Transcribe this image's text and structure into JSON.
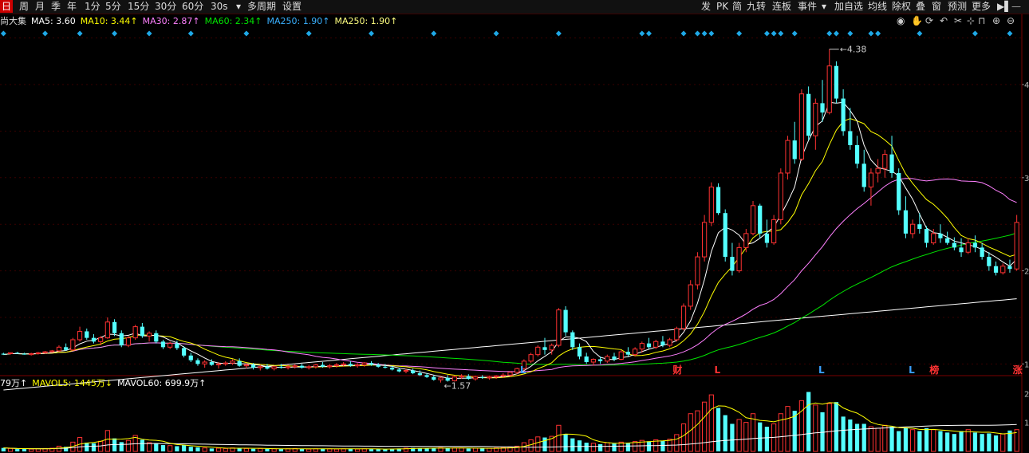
{
  "toolbar": {
    "left": [
      "日",
      "周",
      "月",
      "季",
      "年",
      "1分",
      "5分",
      "15分",
      "30分",
      "60分",
      "30s",
      "▾",
      "多周期",
      "设置"
    ],
    "right": [
      "发",
      "PK",
      "简",
      "九转",
      "连板",
      "事件",
      "▾",
      "加自选",
      "均线",
      "除权",
      "叠",
      "窗",
      "预测",
      "更多"
    ]
  },
  "legend": {
    "name": "尚大集",
    "ma5": "MA5: 3.60",
    "ma10": "MA10: 3.44↑",
    "ma30": "MA30: 2.87↑",
    "ma60": "MA60: 2.34↑",
    "ma250a": "MA250: 1.90↑",
    "ma250b": "MA250: 1.90↑"
  },
  "vol_legend": {
    "vol": "79万↑",
    "mavol5": "MAVOL5: 1445万↓",
    "mavol60": "MAVOL60: 699.9万↑"
  },
  "colors": {
    "up": "#ff3232",
    "down": "#54ffff",
    "ma5": "#ffffff",
    "ma10": "#ffff00",
    "ma30": "#ff80ff",
    "ma60": "#00e600",
    "ma250": "#ffffff",
    "vol_ma5": "#ffff00",
    "vol_ma60": "#ffffff",
    "signal": "#1fa8e6",
    "axis": "#7a0000",
    "marker_l": "#3aa0ff",
    "marker_fin": "#ff3232"
  },
  "chart_data": {
    "type": "candlestick",
    "ylim": [
      0.9,
      4.6
    ],
    "yticks": [
      "1",
      "2",
      "3",
      "4"
    ],
    "vol_ticks": [
      "2",
      "1"
    ],
    "max_label": "4.38",
    "min_label": "1.57",
    "markers": [
      "L",
      "财",
      "L",
      "L",
      "L",
      "榜",
      "涨"
    ],
    "candles": [
      [
        1.11,
        1.12,
        1.1,
        1.1
      ],
      [
        1.11,
        1.12,
        1.1,
        1.12
      ],
      [
        1.12,
        1.13,
        1.11,
        1.11
      ],
      [
        1.11,
        1.12,
        1.1,
        1.1
      ],
      [
        1.1,
        1.12,
        1.09,
        1.11
      ],
      [
        1.11,
        1.13,
        1.1,
        1.12
      ],
      [
        1.12,
        1.14,
        1.11,
        1.13
      ],
      [
        1.13,
        1.15,
        1.12,
        1.14
      ],
      [
        1.14,
        1.2,
        1.13,
        1.18
      ],
      [
        1.18,
        1.22,
        1.14,
        1.15
      ],
      [
        1.15,
        1.28,
        1.14,
        1.26
      ],
      [
        1.26,
        1.4,
        1.24,
        1.35
      ],
      [
        1.35,
        1.38,
        1.26,
        1.28
      ],
      [
        1.28,
        1.32,
        1.22,
        1.24
      ],
      [
        1.24,
        1.3,
        1.2,
        1.28
      ],
      [
        1.28,
        1.5,
        1.27,
        1.45
      ],
      [
        1.45,
        1.48,
        1.3,
        1.33
      ],
      [
        1.33,
        1.36,
        1.18,
        1.2
      ],
      [
        1.2,
        1.3,
        1.18,
        1.28
      ],
      [
        1.28,
        1.42,
        1.26,
        1.4
      ],
      [
        1.4,
        1.44,
        1.28,
        1.3
      ],
      [
        1.3,
        1.35,
        1.24,
        1.33
      ],
      [
        1.33,
        1.36,
        1.22,
        1.24
      ],
      [
        1.24,
        1.26,
        1.16,
        1.18
      ],
      [
        1.18,
        1.24,
        1.16,
        1.22
      ],
      [
        1.22,
        1.25,
        1.15,
        1.17
      ],
      [
        1.17,
        1.19,
        1.07,
        1.09
      ],
      [
        1.09,
        1.12,
        1.02,
        1.04
      ],
      [
        1.04,
        1.06,
        0.98,
        1.0
      ],
      [
        1.0,
        1.04,
        0.96,
        1.02
      ],
      [
        1.02,
        1.05,
        0.98,
        0.99
      ],
      [
        0.99,
        1.02,
        0.95,
        1.0
      ],
      [
        1.0,
        1.03,
        0.98,
        1.01
      ],
      [
        1.01,
        1.05,
        0.99,
        1.03
      ],
      [
        1.03,
        1.06,
        0.97,
        0.98
      ],
      [
        0.98,
        1.01,
        0.95,
        0.99
      ],
      [
        0.99,
        1.01,
        0.94,
        0.96
      ],
      [
        0.96,
        0.99,
        0.93,
        0.97
      ],
      [
        0.97,
        1.0,
        0.94,
        0.95
      ],
      [
        0.95,
        0.98,
        0.93,
        0.97
      ],
      [
        0.97,
        1.0,
        0.95,
        0.96
      ],
      [
        0.96,
        0.99,
        0.94,
        0.97
      ],
      [
        0.97,
        1.0,
        0.95,
        0.98
      ],
      [
        0.98,
        1.0,
        0.95,
        0.96
      ],
      [
        0.96,
        0.99,
        0.94,
        0.97
      ],
      [
        0.97,
        1.0,
        0.95,
        0.99
      ],
      [
        0.99,
        1.02,
        0.96,
        0.97
      ],
      [
        0.97,
        1.0,
        0.95,
        0.98
      ],
      [
        0.98,
        1.01,
        0.96,
        0.99
      ],
      [
        0.99,
        1.02,
        0.97,
        1.0
      ],
      [
        1.0,
        1.03,
        0.97,
        0.98
      ],
      [
        0.98,
        1.01,
        0.96,
        0.99
      ],
      [
        0.99,
        1.02,
        0.97,
        1.01
      ],
      [
        1.01,
        1.03,
        0.98,
        0.99
      ],
      [
        0.99,
        1.01,
        0.96,
        0.97
      ],
      [
        0.97,
        1.0,
        0.95,
        0.96
      ],
      [
        0.96,
        0.98,
        0.93,
        0.94
      ],
      [
        0.94,
        0.96,
        0.91,
        0.92
      ],
      [
        0.92,
        0.95,
        0.9,
        0.93
      ],
      [
        0.93,
        0.95,
        0.89,
        0.9
      ],
      [
        0.9,
        0.93,
        0.87,
        0.88
      ],
      [
        0.88,
        0.9,
        0.85,
        0.86
      ],
      [
        0.86,
        0.88,
        0.82,
        0.83
      ],
      [
        0.83,
        0.86,
        0.8,
        0.85
      ],
      [
        0.85,
        0.88,
        0.81,
        0.82
      ],
      [
        0.82,
        0.87,
        0.81,
        0.86
      ],
      [
        0.86,
        0.89,
        0.84,
        0.87
      ],
      [
        0.87,
        0.89,
        0.83,
        0.84
      ],
      [
        0.84,
        0.87,
        0.82,
        0.86
      ],
      [
        0.86,
        0.88,
        0.84,
        0.85
      ],
      [
        0.85,
        0.87,
        0.83,
        0.86
      ],
      [
        0.86,
        0.88,
        0.84,
        0.87
      ],
      [
        0.87,
        0.9,
        0.85,
        0.88
      ],
      [
        0.88,
        0.92,
        0.86,
        0.91
      ],
      [
        0.91,
        0.96,
        0.89,
        0.95
      ],
      [
        0.95,
        1.05,
        0.93,
        1.03
      ],
      [
        1.03,
        1.12,
        1.01,
        1.1
      ],
      [
        1.1,
        1.2,
        1.08,
        1.18
      ],
      [
        1.18,
        1.28,
        1.1,
        1.15
      ],
      [
        1.15,
        1.22,
        1.1,
        1.2
      ],
      [
        1.2,
        1.6,
        1.18,
        1.58
      ],
      [
        1.58,
        1.62,
        1.3,
        1.34
      ],
      [
        1.34,
        1.36,
        1.15,
        1.18
      ],
      [
        1.18,
        1.22,
        1.05,
        1.08
      ],
      [
        1.08,
        1.12,
        1.0,
        1.02
      ],
      [
        1.02,
        1.06,
        0.98,
        1.05
      ],
      [
        1.05,
        1.08,
        1.0,
        1.03
      ],
      [
        1.03,
        1.1,
        1.01,
        1.08
      ],
      [
        1.08,
        1.12,
        1.03,
        1.05
      ],
      [
        1.05,
        1.15,
        1.04,
        1.13
      ],
      [
        1.13,
        1.18,
        1.08,
        1.1
      ],
      [
        1.1,
        1.18,
        1.08,
        1.16
      ],
      [
        1.16,
        1.24,
        1.12,
        1.22
      ],
      [
        1.22,
        1.28,
        1.16,
        1.18
      ],
      [
        1.18,
        1.26,
        1.16,
        1.24
      ],
      [
        1.24,
        1.3,
        1.18,
        1.2
      ],
      [
        1.2,
        1.28,
        1.18,
        1.26
      ],
      [
        1.26,
        1.4,
        1.24,
        1.38
      ],
      [
        1.38,
        1.65,
        1.36,
        1.62
      ],
      [
        1.62,
        1.9,
        1.58,
        1.85
      ],
      [
        1.85,
        2.2,
        1.8,
        2.15
      ],
      [
        2.15,
        2.6,
        2.1,
        2.52
      ],
      [
        2.52,
        2.95,
        2.48,
        2.9
      ],
      [
        2.9,
        2.94,
        2.6,
        2.62
      ],
      [
        2.62,
        2.66,
        2.1,
        2.15
      ],
      [
        2.15,
        2.3,
        1.95,
        2.0
      ],
      [
        2.0,
        2.3,
        1.98,
        2.25
      ],
      [
        2.25,
        2.45,
        2.2,
        2.4
      ],
      [
        2.4,
        2.75,
        2.38,
        2.7
      ],
      [
        2.7,
        2.72,
        2.35,
        2.4
      ],
      [
        2.4,
        2.55,
        2.25,
        2.3
      ],
      [
        2.3,
        2.6,
        2.28,
        2.55
      ],
      [
        2.55,
        3.1,
        2.5,
        3.05
      ],
      [
        3.05,
        3.45,
        2.98,
        3.4
      ],
      [
        3.4,
        3.6,
        3.15,
        3.2
      ],
      [
        3.2,
        3.95,
        3.18,
        3.9
      ],
      [
        3.9,
        3.98,
        3.4,
        3.45
      ],
      [
        3.45,
        3.85,
        3.3,
        3.8
      ],
      [
        3.8,
        4.05,
        3.6,
        3.7
      ],
      [
        3.7,
        4.38,
        3.68,
        4.2
      ],
      [
        4.2,
        4.25,
        3.8,
        3.85
      ],
      [
        3.85,
        3.95,
        3.45,
        3.5
      ],
      [
        3.5,
        3.75,
        3.3,
        3.35
      ],
      [
        3.35,
        3.45,
        3.1,
        3.15
      ],
      [
        3.15,
        3.3,
        2.85,
        2.9
      ],
      [
        2.9,
        3.1,
        2.7,
        3.05
      ],
      [
        3.05,
        3.2,
        2.95,
        3.1
      ],
      [
        3.1,
        3.3,
        3.0,
        3.25
      ],
      [
        3.25,
        3.45,
        3.0,
        3.05
      ],
      [
        3.05,
        3.1,
        2.6,
        2.65
      ],
      [
        2.65,
        2.8,
        2.35,
        2.4
      ],
      [
        2.4,
        2.55,
        2.35,
        2.5
      ],
      [
        2.5,
        2.62,
        2.4,
        2.45
      ],
      [
        2.45,
        2.48,
        2.25,
        2.3
      ],
      [
        2.3,
        2.45,
        2.28,
        2.4
      ],
      [
        2.4,
        2.5,
        2.3,
        2.35
      ],
      [
        2.35,
        2.42,
        2.28,
        2.3
      ],
      [
        2.3,
        2.36,
        2.22,
        2.25
      ],
      [
        2.25,
        2.35,
        2.15,
        2.2
      ],
      [
        2.2,
        2.35,
        2.18,
        2.3
      ],
      [
        2.3,
        2.38,
        2.2,
        2.25
      ],
      [
        2.25,
        2.3,
        2.12,
        2.15
      ],
      [
        2.15,
        2.2,
        2.0,
        2.05
      ],
      [
        2.05,
        2.1,
        1.95,
        1.98
      ],
      [
        1.98,
        2.08,
        1.96,
        2.05
      ],
      [
        2.05,
        2.12,
        1.98,
        2.02
      ],
      [
        2.02,
        2.6,
        2.0,
        2.52
      ]
    ],
    "volume": [
      0.12,
      0.1,
      0.08,
      0.09,
      0.08,
      0.09,
      0.1,
      0.11,
      0.18,
      0.16,
      0.32,
      0.48,
      0.3,
      0.28,
      0.35,
      0.72,
      0.45,
      0.32,
      0.38,
      0.55,
      0.4,
      0.3,
      0.28,
      0.22,
      0.2,
      0.18,
      0.22,
      0.16,
      0.14,
      0.12,
      0.1,
      0.11,
      0.1,
      0.12,
      0.12,
      0.1,
      0.09,
      0.1,
      0.09,
      0.09,
      0.08,
      0.09,
      0.1,
      0.09,
      0.08,
      0.09,
      0.1,
      0.09,
      0.08,
      0.09,
      0.1,
      0.08,
      0.09,
      0.08,
      0.08,
      0.07,
      0.09,
      0.1,
      0.11,
      0.12,
      0.11,
      0.1,
      0.12,
      0.13,
      0.11,
      0.12,
      0.12,
      0.1,
      0.11,
      0.1,
      0.11,
      0.12,
      0.13,
      0.14,
      0.18,
      0.3,
      0.4,
      0.5,
      0.48,
      0.52,
      0.9,
      0.6,
      0.45,
      0.38,
      0.3,
      0.28,
      0.25,
      0.3,
      0.27,
      0.32,
      0.3,
      0.34,
      0.38,
      0.35,
      0.4,
      0.36,
      0.42,
      0.58,
      0.95,
      1.3,
      1.4,
      1.7,
      1.95,
      1.5,
      1.25,
      0.95,
      1.1,
      1.0,
      1.3,
      1.0,
      0.85,
      0.95,
      1.3,
      1.55,
      1.4,
      1.75,
      2.05,
      1.6,
      1.35,
      1.65,
      1.7,
      1.2,
      1.1,
      0.95,
      0.95,
      0.85,
      0.8,
      0.9,
      0.85,
      0.7,
      0.8,
      0.75,
      0.7,
      0.8,
      0.75,
      0.7,
      0.65,
      0.6,
      0.7,
      0.75,
      0.65,
      0.6,
      0.62,
      0.55,
      0.6,
      0.72,
      0.75
    ]
  }
}
